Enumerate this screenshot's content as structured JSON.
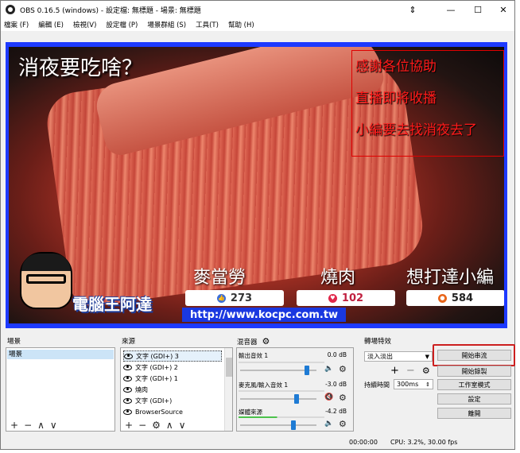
{
  "window": {
    "title": "OBS 0.16.5 (windows) - 設定檔: 無標題 - 場景: 無標題",
    "controls": {
      "minimize": "—",
      "maximize": "☐",
      "close": "✕",
      "extra": "⇕"
    }
  },
  "menubar": [
    "檔案 (F)",
    "編輯 (E)",
    "檢視(V)",
    "設定檔 (P)",
    "場景群組 (S)",
    "工具(T)",
    "幫助 (H)"
  ],
  "preview": {
    "title_overlay": "消夜要吃啥？",
    "red_lines": [
      "感謝各位協助",
      "直播即將收播",
      "小編要去找消夜去了"
    ],
    "labels": [
      "麥當勞",
      "燒肉",
      "想打達小編"
    ],
    "reactions": [
      {
        "icon": "like-icon",
        "count": "273",
        "color": "#3b6fd9"
      },
      {
        "icon": "heart-icon",
        "count": "102",
        "color": "#e0284a"
      },
      {
        "icon": "angry-icon",
        "count": "584",
        "color": "#e8651a"
      }
    ],
    "brand": "電腦王阿達",
    "url": "http://www.kocpc.com.tw"
  },
  "panels": {
    "scenes": {
      "label": "場景",
      "items": [
        "場景"
      ],
      "footer": [
        "+",
        "−",
        "∧",
        "∨"
      ]
    },
    "sources": {
      "label": "來源",
      "items": [
        "文字 (GDI+) 3",
        "文字 (GDI+) 2",
        "文字 (GDI+) 1",
        "燒肉",
        "文字 (GDI+)",
        "BrowserSource"
      ],
      "footer": [
        "+",
        "−",
        "⚙",
        "∧",
        "∨"
      ]
    },
    "mixer": {
      "label": "混音器",
      "channels": [
        {
          "name": "輸出音效 1",
          "level": "0.0 dB",
          "muted": false,
          "volume": 0.88
        },
        {
          "name": "麥克風/輸入音效 1",
          "level": "-3.0 dB",
          "muted": true,
          "volume": 0.74
        },
        {
          "name": "媒體來源",
          "level": "-4.2 dB",
          "muted": false,
          "volume": 0.7
        }
      ]
    },
    "transitions": {
      "label": "轉場特效",
      "selected": "淡入淡出",
      "duration_label": "持續時間",
      "duration_value": "300ms",
      "add": "+",
      "remove": "−"
    }
  },
  "controls": {
    "buttons": [
      "開始串流",
      "開始錄製",
      "工作室模式",
      "設定",
      "離開"
    ]
  },
  "status": {
    "time": "00:00:00",
    "cpu": "CPU: 3.2%, 30.00 fps"
  }
}
